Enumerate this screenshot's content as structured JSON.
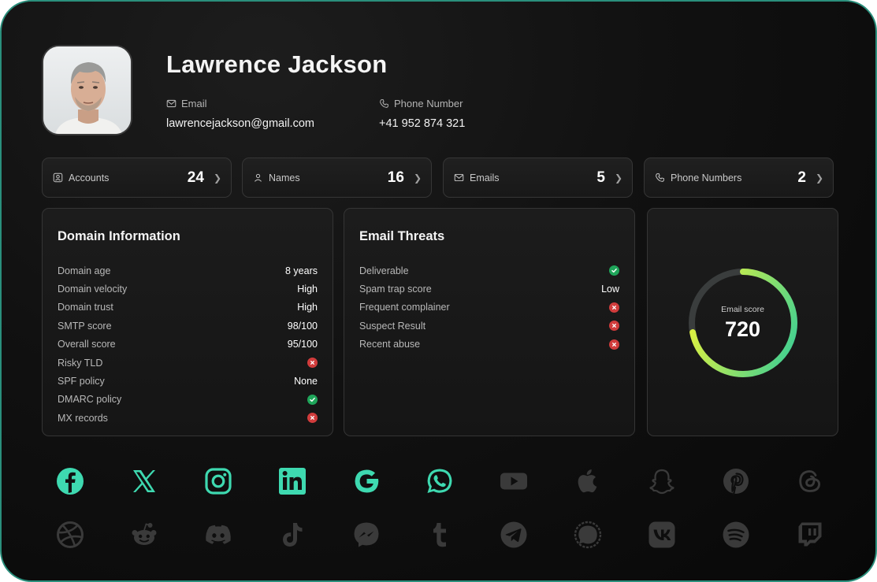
{
  "profile": {
    "name": "Lawrence Jackson",
    "email_label": "Email",
    "email": "lawrencejackson@gmail.com",
    "phone_label": "Phone Number",
    "phone": "+41 952 874 321"
  },
  "stats": [
    {
      "label": "Accounts",
      "value": "24",
      "icon": "user-card-icon"
    },
    {
      "label": "Names",
      "value": "16",
      "icon": "person-icon"
    },
    {
      "label": "Emails",
      "value": "5",
      "icon": "mail-icon"
    },
    {
      "label": "Phone Numbers",
      "value": "2",
      "icon": "phone-icon"
    }
  ],
  "domain": {
    "title": "Domain Information",
    "rows": [
      {
        "label": "Domain age",
        "value": "8 years"
      },
      {
        "label": "Domain velocity",
        "value": "High"
      },
      {
        "label": "Domain trust",
        "value": "High"
      },
      {
        "label": "SMTP score",
        "value": "98/100"
      },
      {
        "label": "Overall score",
        "value": "95/100"
      },
      {
        "label": "Risky TLD",
        "status": "bad"
      },
      {
        "label": "SPF policy",
        "value": "None"
      },
      {
        "label": "DMARC policy",
        "status": "ok"
      },
      {
        "label": "MX records",
        "status": "bad"
      }
    ]
  },
  "threats": {
    "title": "Email Threats",
    "rows": [
      {
        "label": "Deliverable",
        "status": "ok"
      },
      {
        "label": "Spam trap score",
        "value": "Low"
      },
      {
        "label": "Frequent complainer",
        "status": "bad"
      },
      {
        "label": "Suspect Result",
        "status": "bad"
      },
      {
        "label": "Recent abuse",
        "status": "bad"
      }
    ]
  },
  "score": {
    "label": "Email score",
    "value": "720",
    "fraction": 0.72,
    "gradient_start": "#45d08f",
    "gradient_end": "#eaf43a",
    "track_color": "#3a3d3d"
  },
  "colors": {
    "accent": "#3ed9b0",
    "inactive_icon": "#3a3a3a",
    "ok": "#1fa55a",
    "bad": "#d13c3c"
  },
  "socials": {
    "active": [
      "facebook-icon",
      "x-icon",
      "instagram-icon",
      "linkedin-icon",
      "google-icon",
      "whatsapp-icon"
    ],
    "row1": [
      "facebook-icon",
      "x-icon",
      "instagram-icon",
      "linkedin-icon",
      "google-icon",
      "whatsapp-icon",
      "youtube-icon",
      "apple-icon",
      "snapchat-icon",
      "pinterest-icon",
      "threads-icon"
    ],
    "row2": [
      "dribbble-icon",
      "reddit-icon",
      "discord-icon",
      "tiktok-icon",
      "messenger-icon",
      "tumblr-icon",
      "telegram-icon",
      "signal-icon",
      "vk-icon",
      "spotify-icon",
      "twitch-icon"
    ]
  }
}
